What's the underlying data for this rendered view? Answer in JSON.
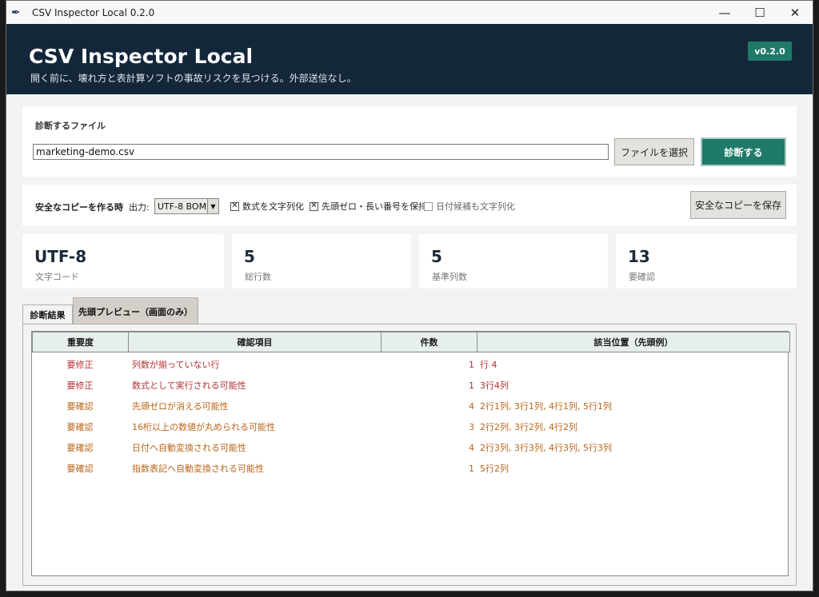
{
  "window": {
    "title": "CSV Inspector Local 0.2.0",
    "controls": {
      "minimize": "—",
      "maximize": "☐",
      "close": "✕"
    }
  },
  "hero": {
    "title": "CSV Inspector Local",
    "subtitle": "開く前に、壊れ方と表計算ソフトの事故リスクを見つける。外部送信なし。",
    "version": "v0.2.0"
  },
  "file_panel": {
    "label": "診断するファイル",
    "file_value": "marketing-demo.csv",
    "select_button": "ファイルを選択",
    "diagnose_button": "診断する"
  },
  "options": {
    "title": "安全なコピーを作る時",
    "output_label": "出力:",
    "output_selected": "UTF-8 BOM",
    "checkboxes": [
      {
        "label": "数式を文字列化",
        "checked": true
      },
      {
        "label": "先頭ゼロ・長い番号を保持",
        "checked": true
      },
      {
        "label": "日付候補も文字列化",
        "checked": false
      }
    ],
    "save_button": "安全なコピーを保存"
  },
  "stats": [
    {
      "value": "UTF-8",
      "label": "文字コード"
    },
    {
      "value": "5",
      "label": "総行数"
    },
    {
      "value": "5",
      "label": "基準列数"
    },
    {
      "value": "13",
      "label": "要確認"
    }
  ],
  "tabs": [
    {
      "label": "診断結果",
      "active": true
    },
    {
      "label": "先頭プレビュー（画面のみ）",
      "active": false
    }
  ],
  "table": {
    "headers": [
      "重要度",
      "確認項目",
      "件数",
      "該当位置（先頭例）"
    ],
    "rows": [
      {
        "severity": "要修正",
        "item": "列数が揃っていない行",
        "count": "1",
        "location": "行 4"
      },
      {
        "severity": "要修正",
        "item": "数式として実行される可能性",
        "count": "1",
        "location": "3行4列"
      },
      {
        "severity": "要確認",
        "item": "先頭ゼロが消える可能性",
        "count": "4",
        "location": "2行1列, 3行1列, 4行1列, 5行1列"
      },
      {
        "severity": "要確認",
        "item": "16桁以上の数値が丸められる可能性",
        "count": "3",
        "location": "2行2列, 3行2列, 4行2列"
      },
      {
        "severity": "要確認",
        "item": "日付へ自動変換される可能性",
        "count": "4",
        "location": "2行3列, 3行3列, 4行3列, 5行3列"
      },
      {
        "severity": "要確認",
        "item": "指数表記へ自動変換される可能性",
        "count": "1",
        "location": "5行2列"
      }
    ]
  },
  "colors": {
    "header_bg": "#14273a",
    "accent": "#1f7a6a",
    "severity_fix": "#b53030",
    "severity_check": "#b8651a"
  }
}
